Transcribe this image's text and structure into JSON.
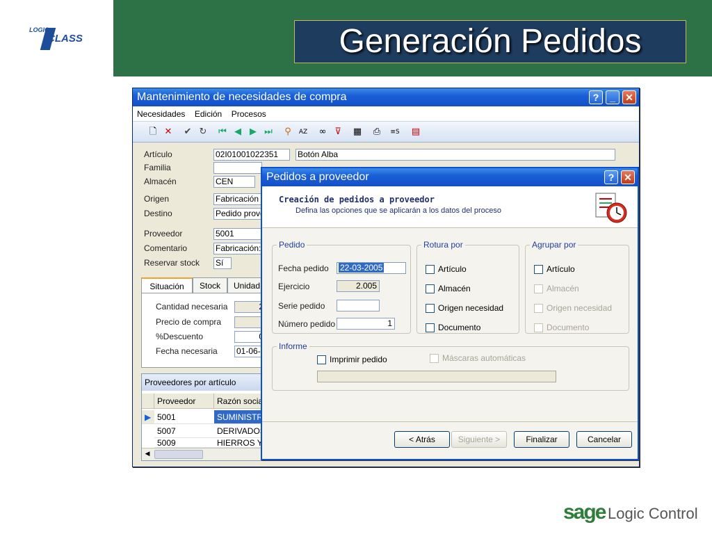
{
  "slide": {
    "title": "Generación Pedidos",
    "logo_top": "LOGIC",
    "logo_main": "CLASS",
    "footer_brand": "sage",
    "footer_product": "Logic Control"
  },
  "main_window": {
    "title": "Mantenimiento de necesidades de compra",
    "menu": [
      "Necesidades",
      "Edición",
      "Procesos"
    ],
    "fields": {
      "articulo_label": "Artículo",
      "articulo_code": "02I01001022351",
      "articulo_desc": "Botón Alba",
      "familia_label": "Familia",
      "almacen_label": "Almacén",
      "almacen_value": "CEN",
      "origen_label": "Origen",
      "origen_value": "Fabricación",
      "destino_label": "Destino",
      "destino_value": "Pedido prove",
      "proveedor_label": "Proveedor",
      "proveedor_value": "5001",
      "comentario_label": "Comentario",
      "comentario_value": "Fabricación: 2",
      "reservar_label": "Reservar stock",
      "reservar_value": "Sí"
    },
    "tabs": [
      "Situación",
      "Stock",
      "Unidad"
    ],
    "situacion": {
      "cantidad_label": "Cantidad necesaria",
      "cantidad_value": "2",
      "precio_label": "Precio de compra",
      "descuento_label": "%Descuento",
      "descuento_value": "0",
      "fecha_label": "Fecha necesaria",
      "fecha_value": "01-06-"
    },
    "proveedores": {
      "title": "Proveedores por artículo",
      "columns": [
        "Proveedor",
        "Razón social"
      ],
      "rows": [
        {
          "proveedor": "5001",
          "razon": "SUMINISTRO"
        },
        {
          "proveedor": "5007",
          "razon": "DERIVADOS"
        },
        {
          "proveedor": "5009",
          "razon": "HIERROS Y"
        }
      ]
    }
  },
  "dialog": {
    "title": "Pedidos a proveedor",
    "heading": "Creación de pedidos a proveedor",
    "subheading": "Defina las opciones que se aplicarán a los datos del proceso",
    "pedido": {
      "title": "Pedido",
      "fecha_label": "Fecha pedido",
      "fecha_value": "22-03-2005",
      "ejercicio_label": "Ejercicio",
      "ejercicio_value": "2.005",
      "serie_label": "Serie pedido",
      "serie_value": "",
      "numero_label": "Número pedido",
      "numero_value": "1"
    },
    "rotura": {
      "title": "Rotura por",
      "options": [
        "Artículo",
        "Almacén",
        "Origen necesidad",
        "Documento"
      ]
    },
    "agrupar": {
      "title": "Agrupar por",
      "options": [
        "Artículo",
        "Almacén",
        "Origen necesidad",
        "Documento"
      ]
    },
    "informe": {
      "title": "Informe",
      "imprimir_label": "Imprimir pedido",
      "mascaras_label": "Máscaras automáticas"
    },
    "buttons": {
      "atras": "< Atrás",
      "siguiente": "Siguiente >",
      "finalizar": "Finalizar",
      "cancelar": "Cancelar"
    }
  },
  "colors": {
    "green": "#2d7146",
    "title_bg": "#1e3c5e",
    "xp_blue": "#1a5fd6"
  }
}
